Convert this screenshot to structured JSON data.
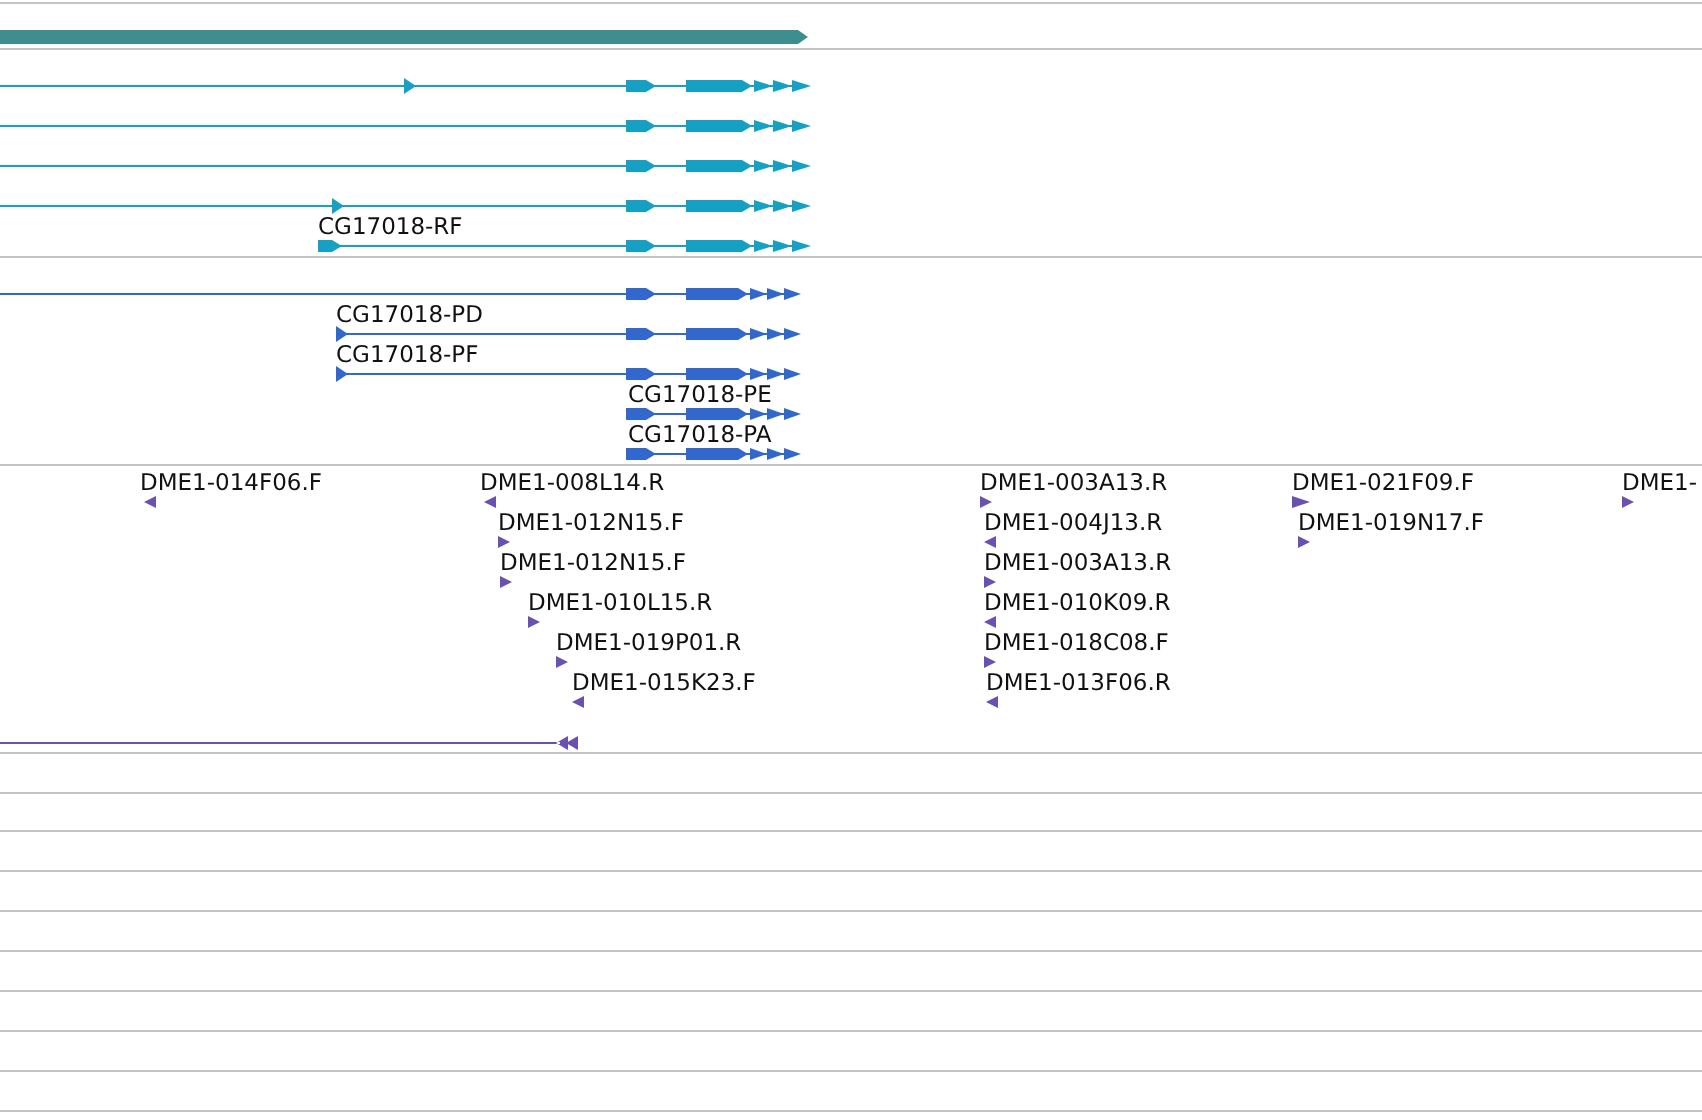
{
  "transcript_track": {
    "labels": [
      "CG17018-RF"
    ]
  },
  "protein_track": {
    "labels": [
      "CG17018-PD",
      "CG17018-PF",
      "CG17018-PE",
      "CG17018-PA"
    ]
  },
  "clone_track": {
    "clones": [
      {
        "label": "DME1-014F06.F",
        "reverse": true
      },
      {
        "label": "DME1-008L14.R",
        "reverse": true
      },
      {
        "label": "DME1-012N15.F",
        "reverse": false
      },
      {
        "label": "DME1-012N15.F",
        "reverse": false
      },
      {
        "label": "DME1-010L15.R",
        "reverse": false
      },
      {
        "label": "DME1-019P01.R",
        "reverse": false
      },
      {
        "label": "DME1-015K23.F",
        "reverse": true
      },
      {
        "label": "DME1-003A13.R",
        "reverse": false
      },
      {
        "label": "DME1-004J13.R",
        "reverse": true
      },
      {
        "label": "DME1-003A13.R",
        "reverse": false
      },
      {
        "label": "DME1-010K09.R",
        "reverse": true
      },
      {
        "label": "DME1-018C08.F",
        "reverse": false
      },
      {
        "label": "DME1-013F06.R",
        "reverse": true
      },
      {
        "label": "DME1-021F09.F",
        "reverse": false
      },
      {
        "label": "DME1-019N17.F",
        "reverse": false
      },
      {
        "label": "DME1-",
        "reverse": false
      }
    ]
  }
}
